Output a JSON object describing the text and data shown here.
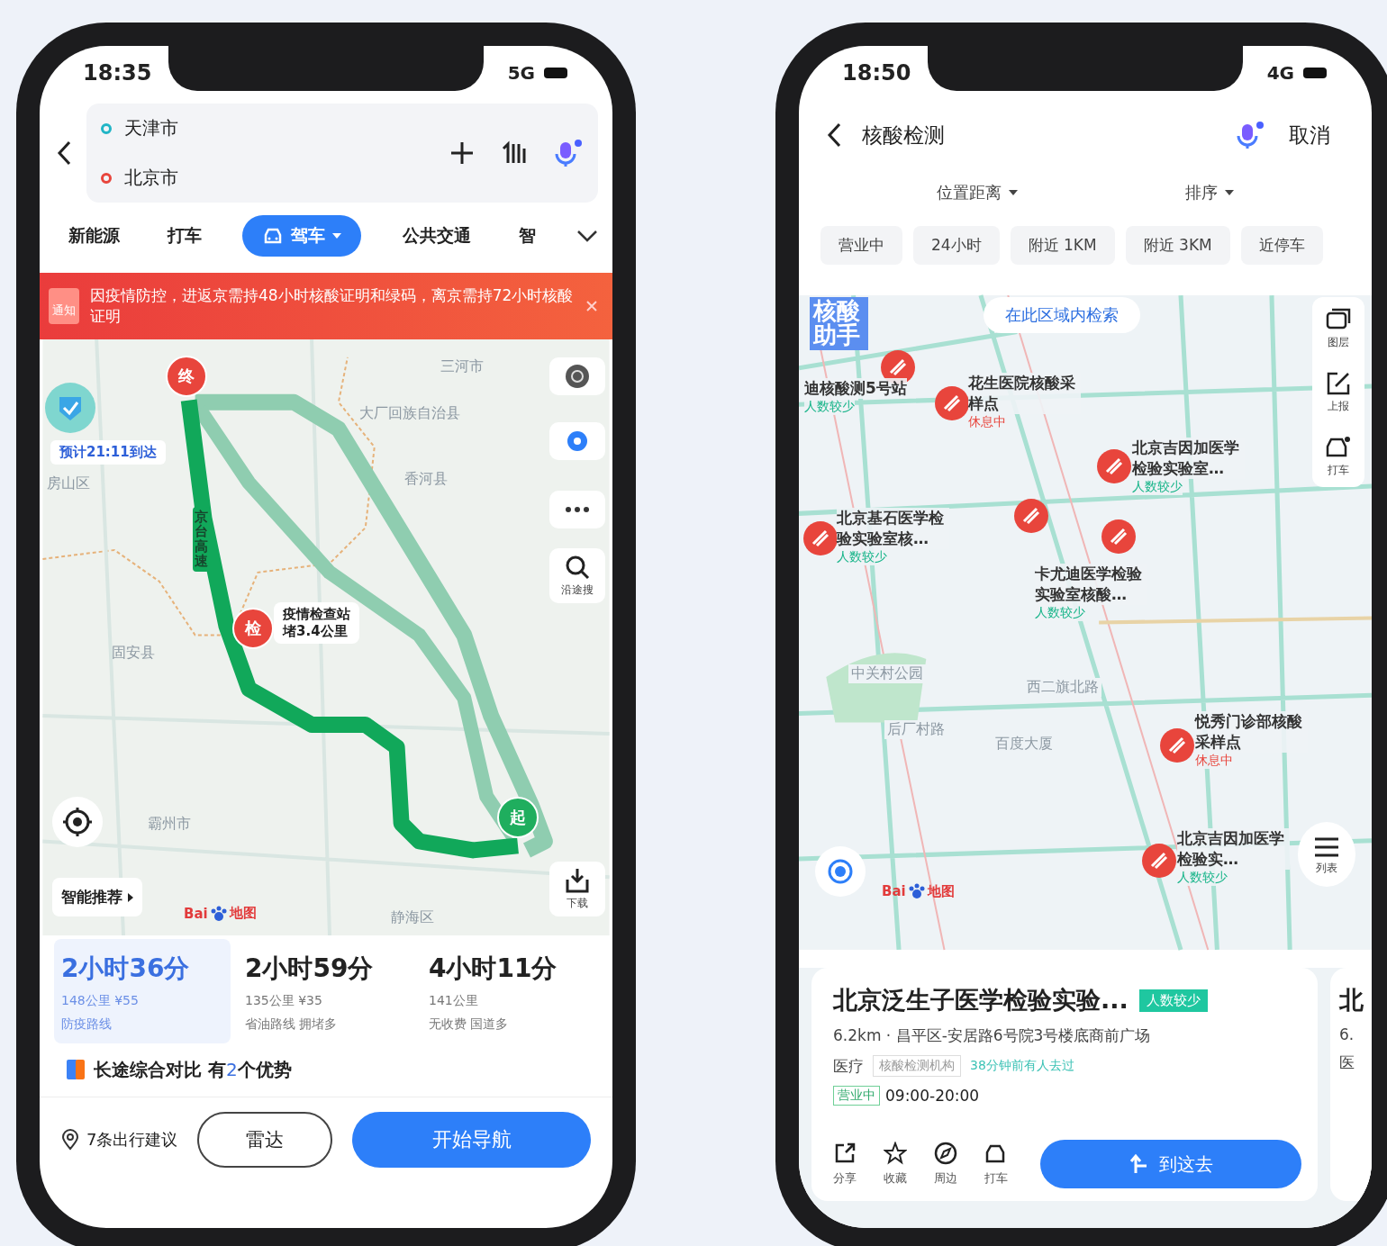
{
  "left_phone": {
    "status_bar": {
      "time": "18:35",
      "network": "5G"
    },
    "route_header": {
      "origin": "天津市",
      "destination": "北京市"
    },
    "modes": [
      {
        "label": "新能源",
        "selected": false
      },
      {
        "label": "打车",
        "selected": false
      },
      {
        "label": "驾车",
        "selected": true
      },
      {
        "label": "公共交通",
        "selected": false
      },
      {
        "label": "智",
        "selected": false
      }
    ],
    "notice": {
      "badge": "通知",
      "text": "因疫情防控，进返京需持48小时核酸证明和绿码，离京需持72小时核酸证明"
    },
    "map": {
      "places": [
        "三河市",
        "大厂回族自治县",
        "香河县",
        "房山区",
        "固安县",
        "霸州市",
        "静海区"
      ],
      "road_label": "京台高速",
      "markers": [
        {
          "label": "终",
          "kind": "end"
        },
        {
          "label": "检",
          "kind": "check"
        },
        {
          "label": "起",
          "kind": "start"
        }
      ],
      "checkpoint": {
        "title": "疫情检查站",
        "detail": "堵3.4公里"
      },
      "arrival": "预计21:11到达",
      "tools": [
        {
          "kind": "layers"
        },
        {
          "kind": "locate"
        },
        {
          "kind": "more"
        },
        {
          "kind": "search",
          "label": "沿途搜"
        },
        {
          "kind": "download",
          "label": "下载"
        }
      ],
      "smart_button": "智能推荐",
      "logo": {
        "left": "Bai",
        "right": "地图"
      }
    },
    "routes": [
      {
        "time": "2小时36分",
        "detail": "148公里 ¥55",
        "tags": "防疫路线",
        "selected": true
      },
      {
        "time": "2小时59分",
        "detail": "135公里 ¥35",
        "tags": "省油路线 拥堵多",
        "selected": false
      },
      {
        "time": "4小时11分",
        "detail": "141公里",
        "tags": "无收费 国道多",
        "selected": false
      }
    ],
    "compare": {
      "before": "长途综合对比 有",
      "highlight": "2",
      "after": "个优势"
    },
    "bottom": {
      "suggestions": "7条出行建议",
      "radar": "雷达",
      "navigate": "开始导航"
    }
  },
  "right_phone": {
    "status_bar": {
      "time": "18:50",
      "network": "4G"
    },
    "search": {
      "query": "核酸检测",
      "cancel": "取消"
    },
    "dropdowns": [
      "位置距离",
      "排序"
    ],
    "chips": [
      "营业中",
      "24小时",
      "附近 1KM",
      "附近 3KM",
      "近停车"
    ],
    "map": {
      "search_here": "在此区域内检索",
      "assistant": "核酸助手",
      "pois": [
        {
          "name": "迪核酸测5号站",
          "status": "人数较少",
          "kind": "few"
        },
        {
          "name": "花生医院核酸采样点",
          "status": "休息中",
          "kind": "closed"
        },
        {
          "name": "北京吉因加医学检验实验室…",
          "status": "人数较少",
          "kind": "few"
        },
        {
          "name": "北京基石医学检验实验室核…",
          "status": "人数较少",
          "kind": "few"
        },
        {
          "name": "卡尤迪医学检验实验室核酸…",
          "status": "人数较少",
          "kind": "few"
        },
        {
          "name": "悦秀门诊部核酸采样点",
          "status": "休息中",
          "kind": "closed"
        },
        {
          "name": "北京吉因加医学检验实…",
          "status": "人数较少",
          "kind": "few"
        }
      ],
      "places": [
        "中关村公园",
        "百度大厦",
        "西二旗北路",
        "后厂村路"
      ],
      "tools": [
        "图层",
        "上报",
        "打车"
      ],
      "list_button": "列表",
      "logo": {
        "left": "Bai",
        "right": "地图"
      }
    },
    "card": {
      "title": "北京泛生子医学检验实验...",
      "crowd": "人数较少",
      "address": "6.2km · 昌平区-安居路6号院3号楼底商前广场",
      "category": "医疗",
      "tag": "核酸检测机构",
      "note": "38分钟前有人去过",
      "open": "营业中",
      "hours": "09:00-20:00",
      "actions": [
        {
          "kind": "share",
          "label": "分享"
        },
        {
          "kind": "star",
          "label": "收藏"
        },
        {
          "kind": "compass",
          "label": "周边"
        },
        {
          "kind": "taxi",
          "label": "打车"
        }
      ],
      "go": "到这去"
    },
    "next_card": {
      "title": "北",
      "distance": "6.",
      "category": "医"
    }
  }
}
